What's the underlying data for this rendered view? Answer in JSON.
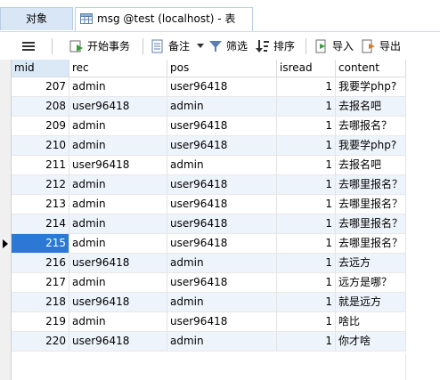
{
  "tabs": {
    "objects_label": "对象",
    "table_tab_label": "msg @test (localhost) - 表"
  },
  "toolbar": {
    "begin_transaction": "开始事务",
    "memo": "备注",
    "filter": "筛选",
    "sort": "排序",
    "import": "导入",
    "export": "导出"
  },
  "columns": [
    "mid",
    "rec",
    "pos",
    "isread",
    "content"
  ],
  "rows": [
    {
      "mid": "207",
      "rec": "admin",
      "pos": "user96418",
      "isread": "1",
      "content": "我要学php?"
    },
    {
      "mid": "208",
      "rec": "user96418",
      "pos": "admin",
      "isread": "1",
      "content": "去报名吧"
    },
    {
      "mid": "209",
      "rec": "admin",
      "pos": "user96418",
      "isread": "1",
      "content": "去哪报名？"
    },
    {
      "mid": "210",
      "rec": "admin",
      "pos": "user96418",
      "isread": "1",
      "content": "我要学php?"
    },
    {
      "mid": "211",
      "rec": "user96418",
      "pos": "admin",
      "isread": "1",
      "content": "去报名吧"
    },
    {
      "mid": "212",
      "rec": "admin",
      "pos": "user96418",
      "isread": "1",
      "content": "去哪里报名？"
    },
    {
      "mid": "213",
      "rec": "admin",
      "pos": "user96418",
      "isread": "1",
      "content": "去哪里报名？"
    },
    {
      "mid": "214",
      "rec": "admin",
      "pos": "user96418",
      "isread": "1",
      "content": "去哪里报名？"
    },
    {
      "mid": "215",
      "rec": "admin",
      "pos": "user96418",
      "isread": "1",
      "content": "去哪里报名？"
    },
    {
      "mid": "216",
      "rec": "user96418",
      "pos": "admin",
      "isread": "1",
      "content": "去远方"
    },
    {
      "mid": "217",
      "rec": "admin",
      "pos": "user96418",
      "isread": "1",
      "content": "远方是哪？"
    },
    {
      "mid": "218",
      "rec": "user96418",
      "pos": "admin",
      "isread": "1",
      "content": "就是远方"
    },
    {
      "mid": "219",
      "rec": "admin",
      "pos": "user96418",
      "isread": "1",
      "content": "啥比"
    },
    {
      "mid": "220",
      "rec": "user96418",
      "pos": "admin",
      "isread": "1",
      "content": "你才啥"
    }
  ],
  "selected_row_mid": "215",
  "colors": {
    "selected": "#2b79d4",
    "alt_row": "#eef4fb",
    "active_tab": "#d8e6f5"
  }
}
